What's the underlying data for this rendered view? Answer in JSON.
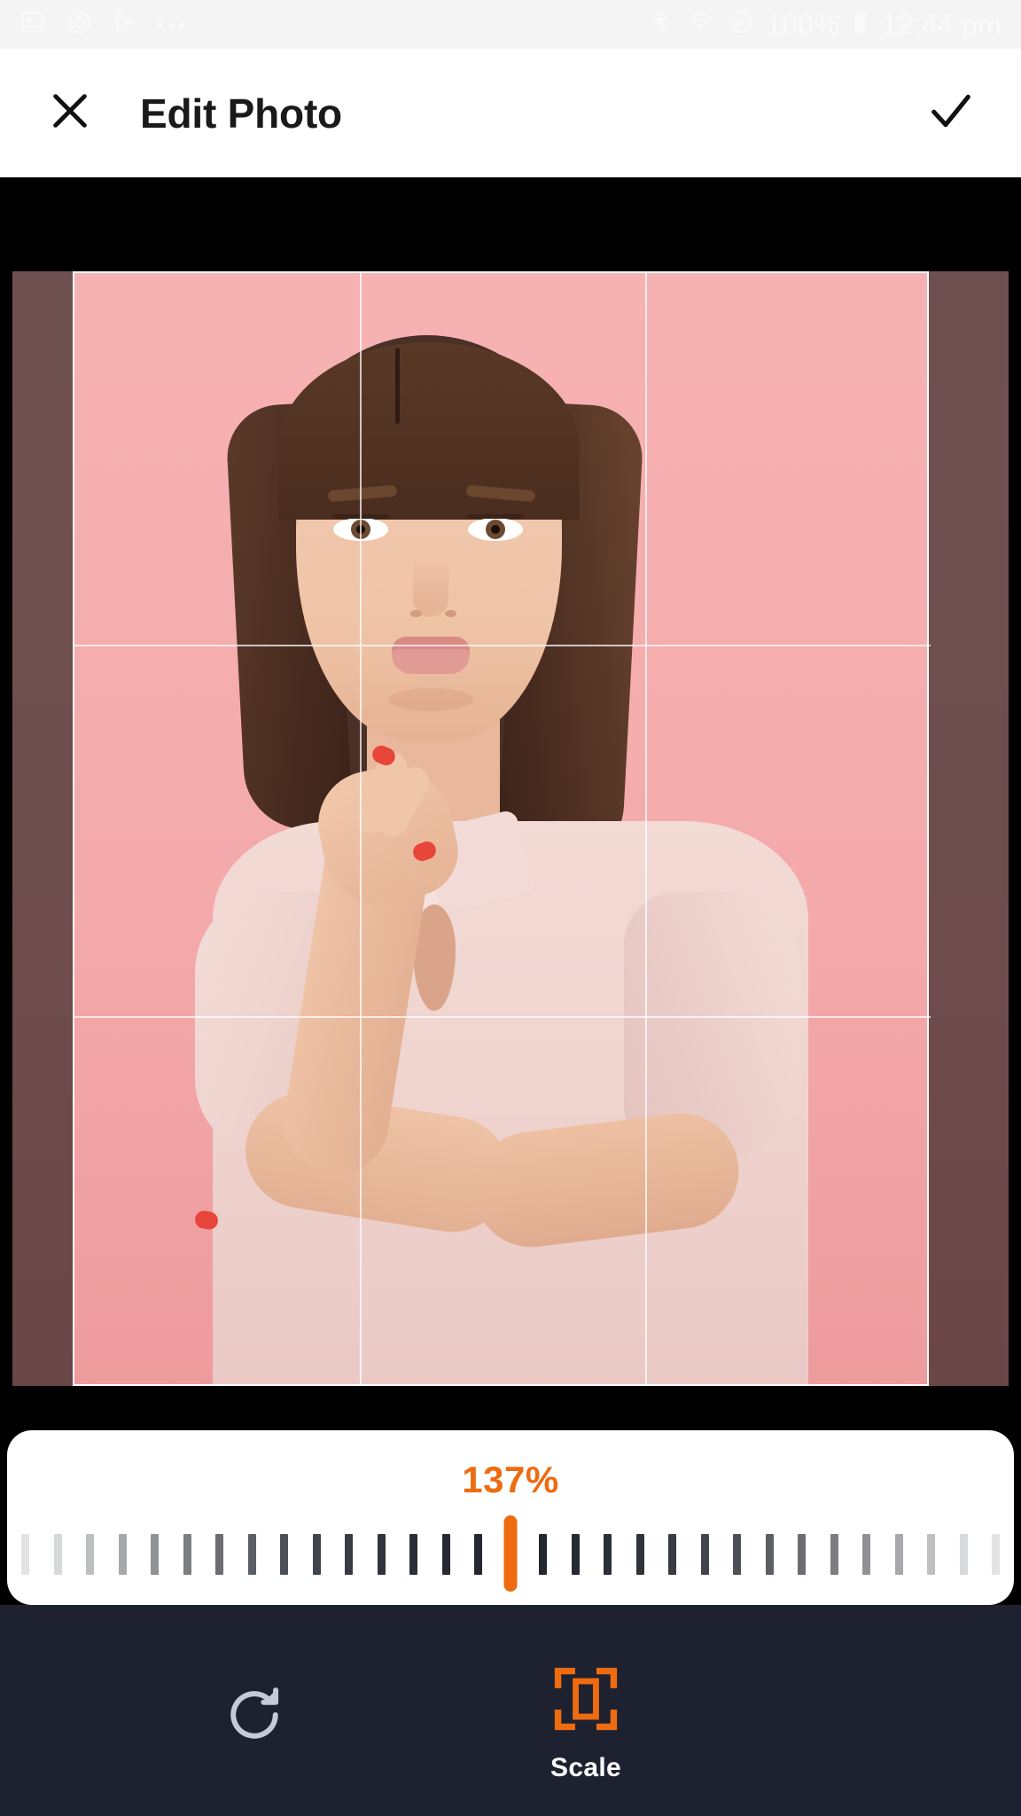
{
  "status_bar": {
    "left_icons": [
      "image-icon",
      "circle-record-icon",
      "play-store-icon",
      "more-dots-icon"
    ],
    "right_icons": [
      "bluetooth-icon",
      "wifi-icon",
      "do-not-disturb-icon",
      "battery-icon"
    ],
    "battery_percent": "100%",
    "time": "12:44 pm",
    "background_color": "#F4F4F4",
    "text_color": "#FAFAFA"
  },
  "app_bar": {
    "close_icon": "close-icon",
    "title": "Edit Photo",
    "done_icon": "check-icon",
    "background_color": "#FFFFFF",
    "title_color": "#1A1A1A"
  },
  "editor": {
    "crop_grid": {
      "columns": 3,
      "rows": 3,
      "line_color": "#FFFFFF"
    },
    "crop_border_color": "#FFFFFF",
    "dim_color": "rgba(0,0,0,0.55)",
    "stage_background": "#000000"
  },
  "scale_slider": {
    "value_label": "137%",
    "value_color": "#EE6B10",
    "thumb_color": "#EE6B10",
    "tick_color": "#23272E",
    "tick_count": 31,
    "card_background": "#FFFFFF"
  },
  "toolbar": {
    "background_color": "#1E2230",
    "items": [
      {
        "icon": "rotate-icon",
        "label": "",
        "active": false,
        "color": "#C5CBD6"
      },
      {
        "icon": "scale-icon",
        "label": "Scale",
        "active": true,
        "color": "#EE6B10"
      }
    ]
  },
  "chart_data": null
}
